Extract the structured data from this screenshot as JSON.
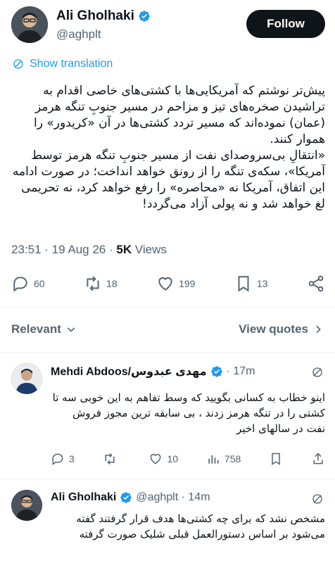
{
  "author": {
    "name": "Ali Gholhaki",
    "handle": "@aghplt",
    "follow_label": "Follow"
  },
  "translate_label": "Show translation",
  "tweet": {
    "paragraphs": [
      "پیش‌تر نوشتم که آمریکایی‌ها با کشتی‌های خاصی اقدام به تراشیدن صخره‌های تیز و مزاحم در مسیر جنوبِ تنگه هرمز (عمان) نموده‌اند که مسیر تردد کشتی‌ها در آن «کریدور» را هموار کنند.",
      "«انتقالِ بی‌سروصدای نفت از مسیر جنوبِ تنگه هرمز توسط آمریکا»، سکه‌ی تنگه را از رونق خواهد انداخت؛ در صورت ادامه این اتفاق، آمریکا نه «محاصره» را رفع خواهد کرد، نه تحریمی لغ خواهد شد و نه پولی آزاد می‌گردد!"
    ],
    "time": "23:51",
    "date": "19 Aug 26",
    "views_count": "5K",
    "views_label": "Views",
    "replies": "60",
    "reposts": "18",
    "likes": "199",
    "bookmarks": "13"
  },
  "sort": {
    "relevant_label": "Relevant",
    "view_quotes_label": "View quotes"
  },
  "replies": [
    {
      "name": "Mehdi Abdoos/مهدی عبدوس",
      "meta": "· 17m",
      "text": "اینو خطاب به کسانی بگویید که وسط تفاهم به این خوبی سه تا کشتی را در تنگه هرمز زدند ، بی سابقه ترین مجوز فروش نفت در سالهای اخیر",
      "replies": "3",
      "reposts": "",
      "likes": "10",
      "views": "758"
    },
    {
      "name": "Ali Gholhaki",
      "meta": "@aghplt · 14m",
      "text": "مشخص نشد که برای چه کشتی‌ها هدف قرار گرفتند گفته می‌شود بر اساس دستورالعمل قبلی شلیک صورت گرفته"
    }
  ],
  "colors": {
    "accent": "#1d9bf0",
    "text": "#0f1419",
    "muted": "#536471",
    "divider": "#eff3f4"
  },
  "icons": [
    "verified-badge-icon",
    "translate-icon",
    "reply-icon",
    "repost-icon",
    "like-icon",
    "bookmark-icon",
    "share-icon",
    "chevron-down-icon",
    "chevron-right-icon",
    "grok-icon",
    "views-icon"
  ]
}
